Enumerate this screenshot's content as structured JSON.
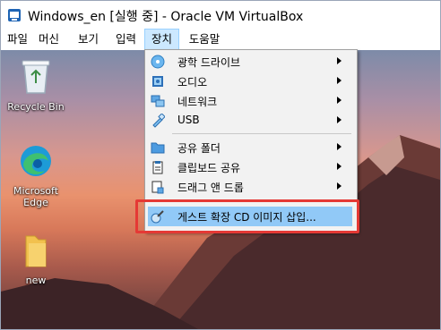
{
  "window": {
    "title": "Windows_en [실행 중] - Oracle VM VirtualBox"
  },
  "menubar": {
    "items": [
      {
        "label": "파일"
      },
      {
        "label": "머신"
      },
      {
        "label": "보기"
      },
      {
        "label": "입력"
      },
      {
        "label": "장치"
      },
      {
        "label": "도움말"
      }
    ],
    "active": "장치"
  },
  "desktop": {
    "icons": [
      {
        "label": "Recycle Bin",
        "icon": "recycle-bin-icon"
      },
      {
        "label_line1": "Microsoft",
        "label_line2": "Edge",
        "icon": "edge-icon"
      },
      {
        "label": "new",
        "icon": "folder-icon"
      }
    ]
  },
  "devices_menu": {
    "items": [
      {
        "label": "광학 드라이브",
        "icon": "optical-drive-icon",
        "submenu": true
      },
      {
        "label": "오디오",
        "icon": "audio-icon",
        "submenu": true
      },
      {
        "label": "네트워크",
        "icon": "network-icon",
        "submenu": true
      },
      {
        "label": "USB",
        "icon": "usb-icon",
        "submenu": true
      },
      {
        "label": "공유 폴더",
        "icon": "shared-folder-icon",
        "submenu": true
      },
      {
        "label": "클립보드 공유",
        "icon": "clipboard-icon",
        "submenu": true
      },
      {
        "label": "드래그 앤 드롭",
        "icon": "drag-drop-icon",
        "submenu": true
      },
      {
        "label": "게스트 확장 CD 이미지 삽입...",
        "icon": "guest-additions-icon",
        "submenu": false,
        "highlighted": true
      }
    ]
  },
  "colors": {
    "highlight": "#91c9f7",
    "active_menu": "#cce8ff",
    "annotation_box": "#e53935"
  }
}
